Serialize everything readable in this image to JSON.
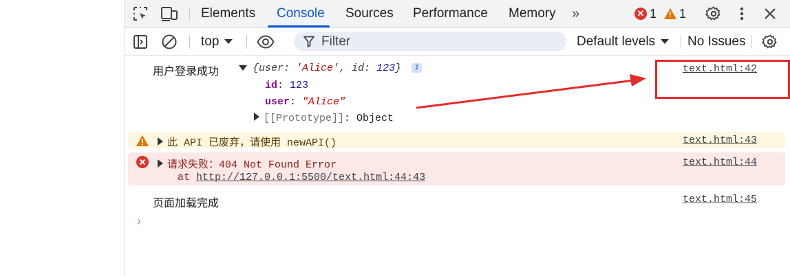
{
  "tabs": [
    "Elements",
    "Console",
    "Sources",
    "Performance",
    "Memory"
  ],
  "more_tabs": "»",
  "error_count": "1",
  "warning_count": "1",
  "toolbar": {
    "context": "top",
    "filter_placeholder": "Filter",
    "levels": "Default levels",
    "issues": "No Issues"
  },
  "messages": {
    "log1": {
      "text": "用户登录成功",
      "object_preview": {
        "open": "{",
        "k1": "user",
        "v1": "'Alice'",
        "k2": "id",
        "v2": "123",
        "close": "}"
      },
      "info_badge": "i",
      "props": {
        "id_key": "id",
        "id_val": "123",
        "user_key": "user",
        "user_val": "\"Alice\"",
        "proto_key": "[[Prototype]]",
        "proto_val": "Object"
      },
      "source": "text.html:42"
    },
    "warning": {
      "text": "此 API 已废弃，请使用 newAPI()",
      "source": "text.html:43"
    },
    "error": {
      "text": "请求失败：404 Not Found Error",
      "stack_prefix": "at",
      "stack_link": "http://127.0.0.1:5500/text.html:44:43",
      "source": "text.html:44"
    },
    "log2": {
      "text": "页面加载完成",
      "source": "text.html:45"
    }
  },
  "prompt_symbol": "›",
  "colors": {
    "accent": "#0b57d0",
    "error": "#dc362e",
    "warning": "#e37400",
    "annotation": "#e22b2b"
  }
}
